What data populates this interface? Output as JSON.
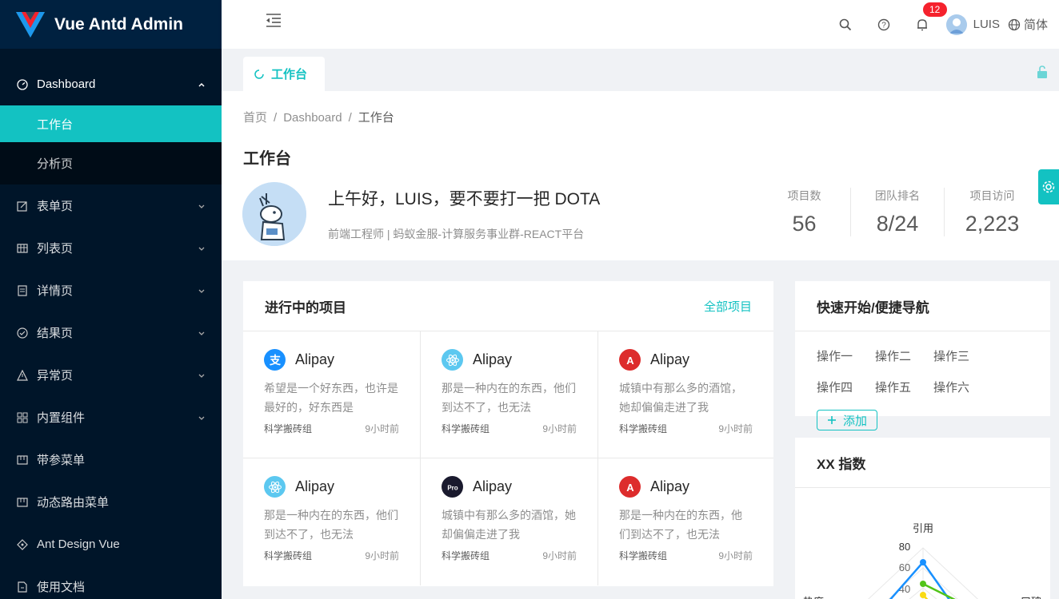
{
  "app": {
    "title": "Vue Antd Admin"
  },
  "sidebar": {
    "dashboard": "Dashboard",
    "sub": [
      "工作台",
      "分析页"
    ],
    "items": [
      {
        "label": "表单页",
        "icon": "form-icon"
      },
      {
        "label": "列表页",
        "icon": "table-icon"
      },
      {
        "label": "详情页",
        "icon": "profile-icon"
      },
      {
        "label": "结果页",
        "icon": "check-circle-icon"
      },
      {
        "label": "异常页",
        "icon": "warning-icon"
      },
      {
        "label": "内置组件",
        "icon": "appstore-icon"
      },
      {
        "label": "带参菜单",
        "icon": "menu-icon"
      },
      {
        "label": "动态路由菜单",
        "icon": "menu-icon"
      },
      {
        "label": "Ant Design Vue",
        "icon": "ant-design-icon"
      },
      {
        "label": "使用文档",
        "icon": "file-icon"
      }
    ]
  },
  "header": {
    "notification_count": "12",
    "user_name": "LUIS",
    "language": "简体"
  },
  "tabs": {
    "active": "工作台"
  },
  "page": {
    "breadcrumb": [
      "首页",
      "Dashboard",
      "工作台"
    ],
    "title": "工作台",
    "greeting": "上午好，LUIS，要不要打一把 DOTA",
    "subtitle": "前端工程师 | 蚂蚁金服-计算服务事业群-REACT平台",
    "stats": [
      {
        "label": "项目数",
        "value": "56"
      },
      {
        "label": "团队排名",
        "value": "8/24"
      },
      {
        "label": "项目访问",
        "value": "2,223"
      }
    ]
  },
  "projects": {
    "title": "进行中的项目",
    "extra": "全部项目",
    "items": [
      {
        "name": "Alipay",
        "logo": "alipay-icon",
        "desc": "希望是一个好东西，也许是最好的，好东西是",
        "group": "科学搬砖组",
        "time": "9小时前"
      },
      {
        "name": "Alipay",
        "logo": "react-icon",
        "desc": "那是一种内在的东西，他们到达不了，也无法",
        "group": "科学搬砖组",
        "time": "9小时前"
      },
      {
        "name": "Alipay",
        "logo": "angular-icon",
        "desc": "城镇中有那么多的酒馆，她却偏偏走进了我",
        "group": "科学搬砖组",
        "time": "9小时前"
      },
      {
        "name": "Alipay",
        "logo": "react-icon",
        "desc": "那是一种内在的东西，他们到达不了，也无法",
        "group": "科学搬砖组",
        "time": "9小时前"
      },
      {
        "name": "Alipay",
        "logo": "pro-icon",
        "desc": "城镇中有那么多的酒馆，她却偏偏走进了我",
        "group": "科学搬砖组",
        "time": "9小时前"
      },
      {
        "name": "Alipay",
        "logo": "angular-icon",
        "desc": "那是一种内在的东西，他们到达不了，也无法",
        "group": "科学搬砖组",
        "time": "9小时前"
      }
    ]
  },
  "quick_nav": {
    "title": "快速开始/便捷导航",
    "links": [
      "操作一",
      "操作二",
      "操作三",
      "操作四",
      "操作五",
      "操作六"
    ],
    "add_label": "添加"
  },
  "radar": {
    "title": "XX 指数",
    "labels": [
      "引用",
      "热度",
      "口碑"
    ],
    "ticks": [
      "80",
      "60",
      "40"
    ],
    "colors": [
      "#1890ff",
      "#52c41a",
      "#fadb14"
    ]
  },
  "colors": {
    "accent": "#13c2c2",
    "sidebar": "#001529",
    "badge": "#f5222d"
  }
}
